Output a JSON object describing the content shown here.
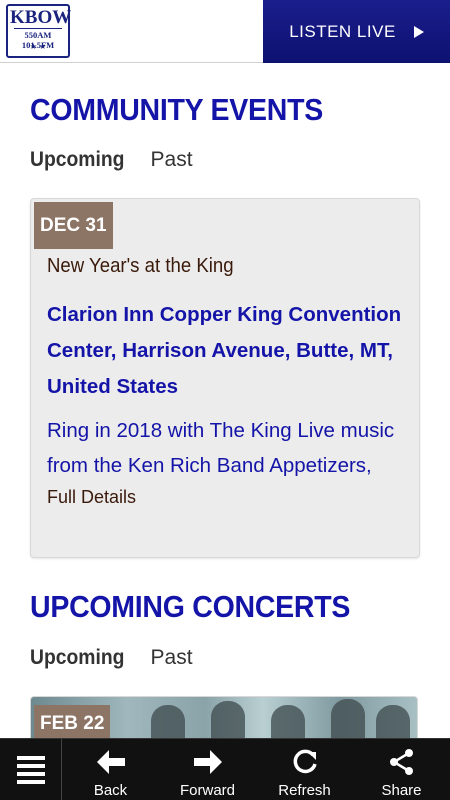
{
  "header": {
    "logo_main": "KBOW",
    "logo_sub": "550AM 101.5FM",
    "logo_stars": "★ ★",
    "listen_label": "LISTEN LIVE"
  },
  "community": {
    "title": "COMMUNITY EVENTS",
    "tab_upcoming": "Upcoming",
    "tab_past": "Past",
    "event": {
      "date": "DEC 31",
      "title": "New Year's at the King",
      "venue": "Clarion Inn Copper King Convention Center, Harrison Avenue, Butte, MT, United States",
      "description": "Ring in 2018 with The King Live music from the Ken Rich Band Appetizers,",
      "details_label": "Full Details"
    }
  },
  "concerts": {
    "title": "UPCOMING CONCERTS",
    "tab_upcoming": "Upcoming",
    "tab_past": "Past",
    "first_date": "FEB 22"
  },
  "bottombar": {
    "back": "Back",
    "forward": "Forward",
    "refresh": "Refresh",
    "share": "Share"
  },
  "colors": {
    "accent": "#1414a8",
    "listen_bg": "#1a1e8c",
    "badge": "#8d7566",
    "bottombar": "#111111"
  },
  "icons": [
    "menu-icon",
    "arrow-left-icon",
    "arrow-right-icon",
    "refresh-icon",
    "share-icon",
    "play-icon"
  ]
}
